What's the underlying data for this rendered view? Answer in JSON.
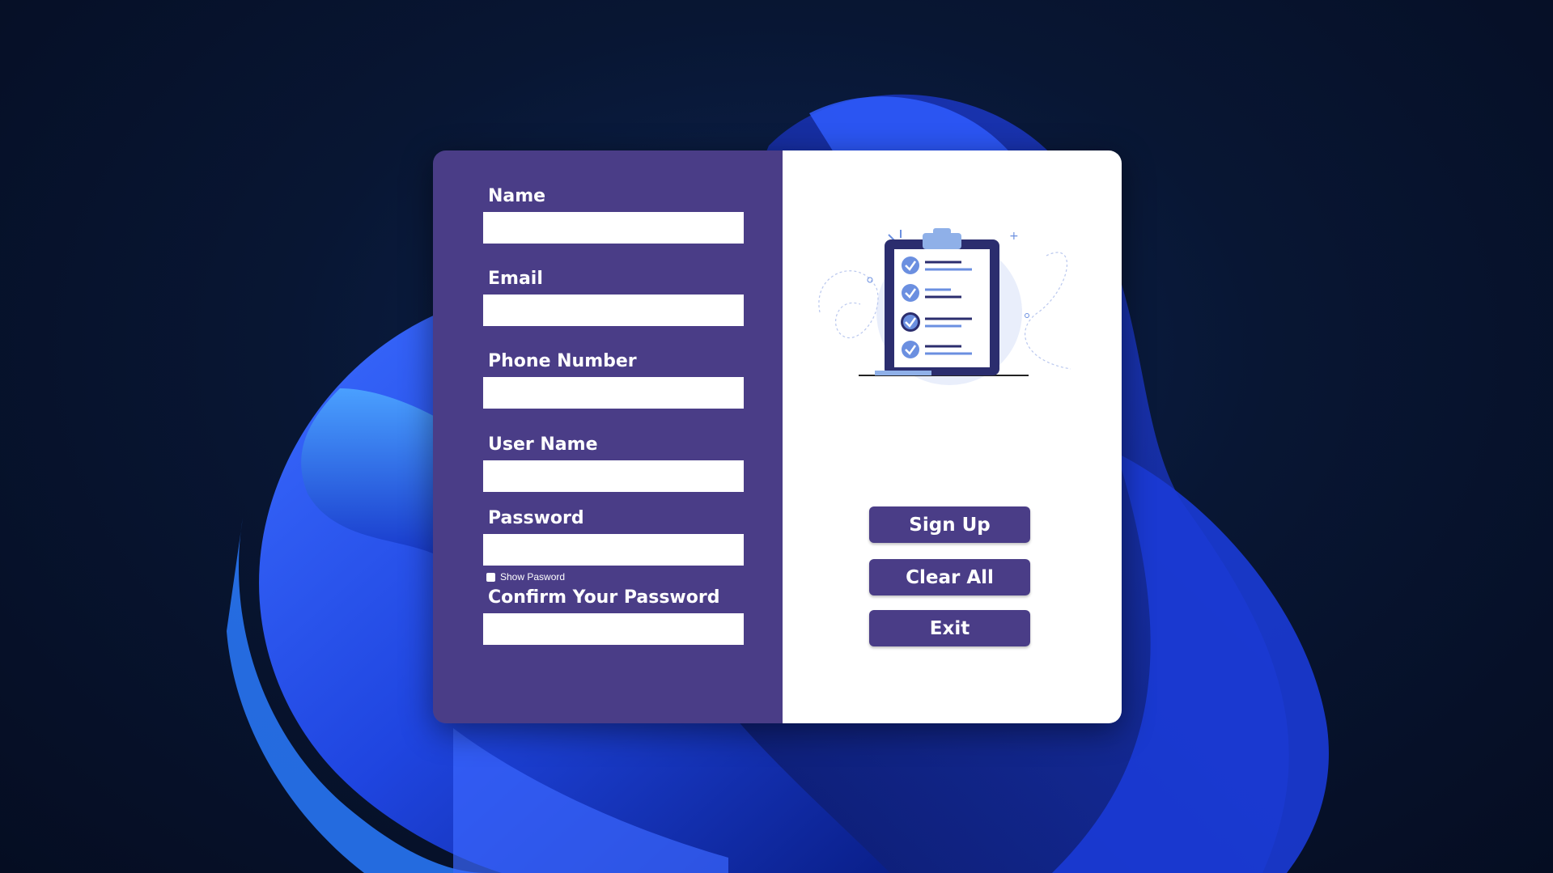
{
  "form": {
    "name_label": "Name",
    "email_label": "Email",
    "phone_label": "Phone Number",
    "username_label": "User Name",
    "password_label": "Password",
    "show_password_label": "Show Pasword",
    "confirm_password_label": "Confirm Your Password",
    "name_value": "",
    "email_value": "",
    "phone_value": "",
    "username_value": "",
    "password_value": "",
    "confirm_password_value": ""
  },
  "actions": {
    "sign_up": "Sign Up",
    "clear_all": "Clear All",
    "exit": "Exit"
  },
  "theme": {
    "panel_color": "#4a3d87",
    "background_color": "#ffffff",
    "accent_blue": "#2563eb"
  },
  "icons": {
    "illustration": "clipboard-checklist-icon",
    "checkbox": "checkbox-icon"
  }
}
